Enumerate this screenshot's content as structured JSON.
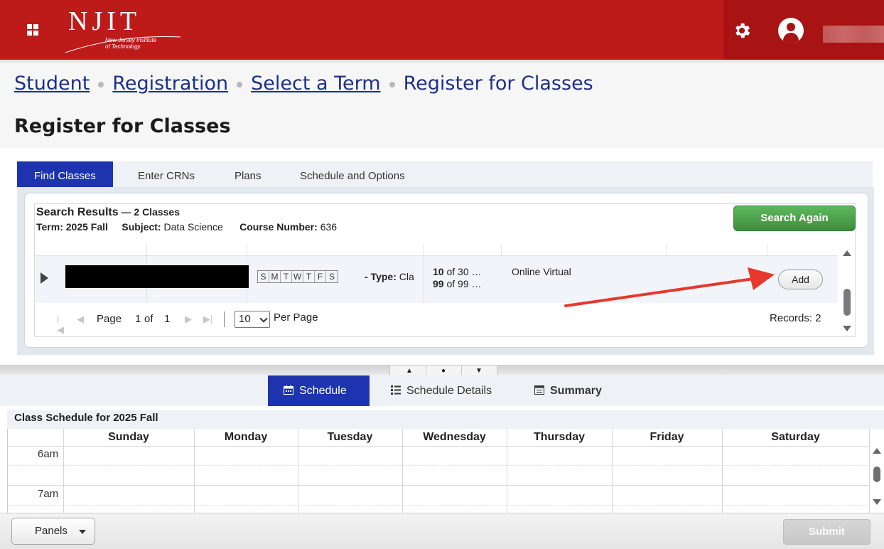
{
  "header": {
    "logo_main": "NJIT",
    "logo_sub_line1": "New Jersey Institute",
    "logo_sub_line2": "of Technology",
    "brand_color": "#bd1a1a",
    "apps_icon": "apps-grid-icon",
    "settings_icon": "gear-icon",
    "user_icon": "user-avatar-icon"
  },
  "breadcrumb": {
    "items": [
      "Student",
      "Registration",
      "Select a Term"
    ],
    "current": "Register for Classes"
  },
  "page_title": "Register for Classes",
  "tabs": [
    {
      "label": "Find Classes",
      "active": true
    },
    {
      "label": "Enter CRNs",
      "active": false
    },
    {
      "label": "Plans",
      "active": false
    },
    {
      "label": "Schedule and Options",
      "active": false
    }
  ],
  "search_results": {
    "title": "Search Results",
    "count_label": " — 2 Classes",
    "term_label": "Term:",
    "term_value": "2025 Fall",
    "subject_label": "Subject:",
    "subject_value": "Data Science",
    "course_label": "Course Number:",
    "course_value": "636",
    "search_again_label": "Search Again",
    "row": {
      "days": [
        "S",
        "M",
        "T",
        "W",
        "T",
        "F",
        "S"
      ],
      "type_label": "- Type:",
      "type_value": " Cla",
      "seats_bold": "10",
      "seats_rest": " of 30 …",
      "waitlist_bold": "99",
      "waitlist_rest": " of 99 …",
      "campus": "Online Virtual",
      "add_label": "Add"
    },
    "pager": {
      "page_label": "Page",
      "page_current": "1",
      "of_label": "of",
      "page_total": "1",
      "per_page_value": "10",
      "per_page_label": "Per Page",
      "records_label": "Records: 2"
    }
  },
  "bottom_tabs": [
    {
      "label": "Schedule",
      "active": true,
      "icon": "calendar-icon"
    },
    {
      "label": "Schedule Details",
      "active": false,
      "icon": "list-icon"
    },
    {
      "label": "Summary",
      "active": false,
      "icon": "summary-table-icon"
    }
  ],
  "schedule": {
    "heading": "Class Schedule for 2025 Fall",
    "days": [
      "Sunday",
      "Monday",
      "Tuesday",
      "Wednesday",
      "Thursday",
      "Friday",
      "Saturday"
    ],
    "times": [
      "6am",
      "7am"
    ]
  },
  "footer": {
    "panels_label": "Panels",
    "submit_label": "Submit"
  },
  "annotation": {
    "arrow_color": "#e8372c"
  }
}
